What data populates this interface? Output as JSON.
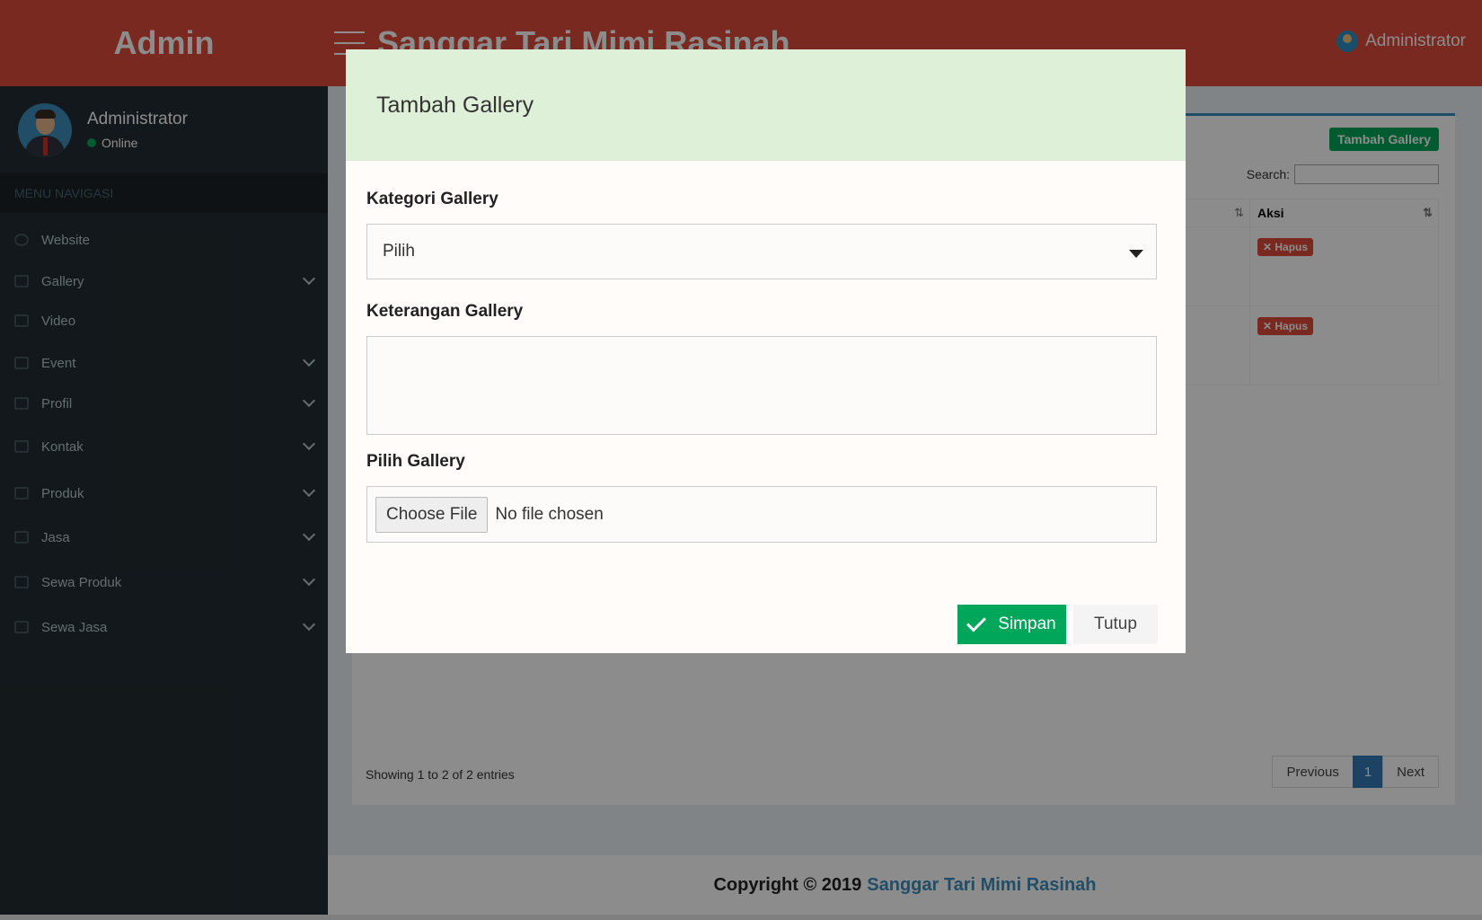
{
  "header": {
    "logo": "Admin",
    "title": "Sanggar Tari Mimi Rasinah",
    "user": "Administrator"
  },
  "sidebar": {
    "user_name": "Administrator",
    "status": "Online",
    "menu_header": "MENU NAVIGASI",
    "items": [
      {
        "label": "Website",
        "icon": "globe-icon"
      },
      {
        "label": "Gallery",
        "icon": "image-icon"
      },
      {
        "label": "Video",
        "icon": "video-icon"
      },
      {
        "label": "Event",
        "icon": "file-icon"
      },
      {
        "label": "Profil",
        "icon": "file-icon"
      },
      {
        "label": "Kontak",
        "icon": "file-icon"
      },
      {
        "label": "Produk",
        "icon": "list-icon"
      },
      {
        "label": "Jasa",
        "icon": "list-icon"
      },
      {
        "label": "Sewa Produk",
        "icon": "list-icon"
      },
      {
        "label": "Sewa Jasa",
        "icon": "list-icon"
      }
    ]
  },
  "content": {
    "add_button": "Tambah Gallery",
    "search_label": "Search:",
    "column_aksi": "Aksi",
    "rows": [
      {
        "action": "Hapus"
      },
      {
        "action": "Hapus"
      }
    ],
    "entries_info": "Showing 1 to 2 of 2 entries",
    "pagination": {
      "previous": "Previous",
      "page": "1",
      "next": "Next"
    }
  },
  "footer": {
    "copyright": "Copyright © 2019",
    "link": "Sanggar Tari Mimi Rasinah"
  },
  "modal": {
    "title": "Tambah Gallery",
    "kategori_label": "Kategori Gallery",
    "kategori_value": "Pilih",
    "keterangan_label": "Keterangan Gallery",
    "pilih_label": "Pilih Gallery",
    "choose_file": "Choose File",
    "no_file": "No file chosen",
    "save": "Simpan",
    "close": "Tutup"
  },
  "colors": {
    "header": "#dd4b39",
    "sidebar": "#222d32",
    "success": "#00a65a",
    "danger": "#dd4b39",
    "modal_header": "#dff0d8"
  }
}
